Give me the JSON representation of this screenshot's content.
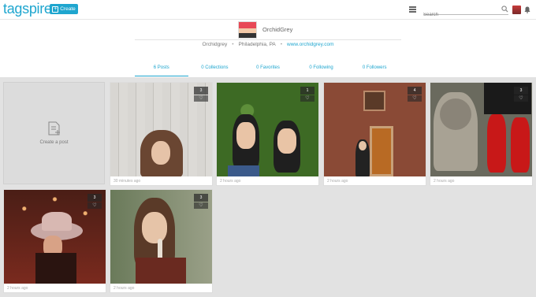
{
  "header": {
    "logo": "tagspire",
    "create_label": "Create",
    "search_placeholder": "Search"
  },
  "profile": {
    "username": "OrchidGrey",
    "handle": "Orchidgrey",
    "location": "Philadelphia, PA",
    "website": "www.orchidgrey.com"
  },
  "tabs": [
    {
      "label": "6 Posts"
    },
    {
      "label": "0 Collections"
    },
    {
      "label": "0 Favorites"
    },
    {
      "label": "0 Following"
    },
    {
      "label": "0 Followers"
    }
  ],
  "create_post": {
    "label": "Create a post"
  },
  "posts": [
    {
      "time": "30 minutes ago",
      "count": "3"
    },
    {
      "time": "2 hours ago",
      "count": "1"
    },
    {
      "time": "2 hours ago",
      "count": "4"
    },
    {
      "time": "2 hours ago",
      "count": "3"
    },
    {
      "time": "2 hours ago",
      "count": "3"
    },
    {
      "time": "2 hours ago",
      "count": "3"
    }
  ],
  "colors": {
    "accent": "#1fa6cf",
    "background": "#e2e2e2"
  }
}
